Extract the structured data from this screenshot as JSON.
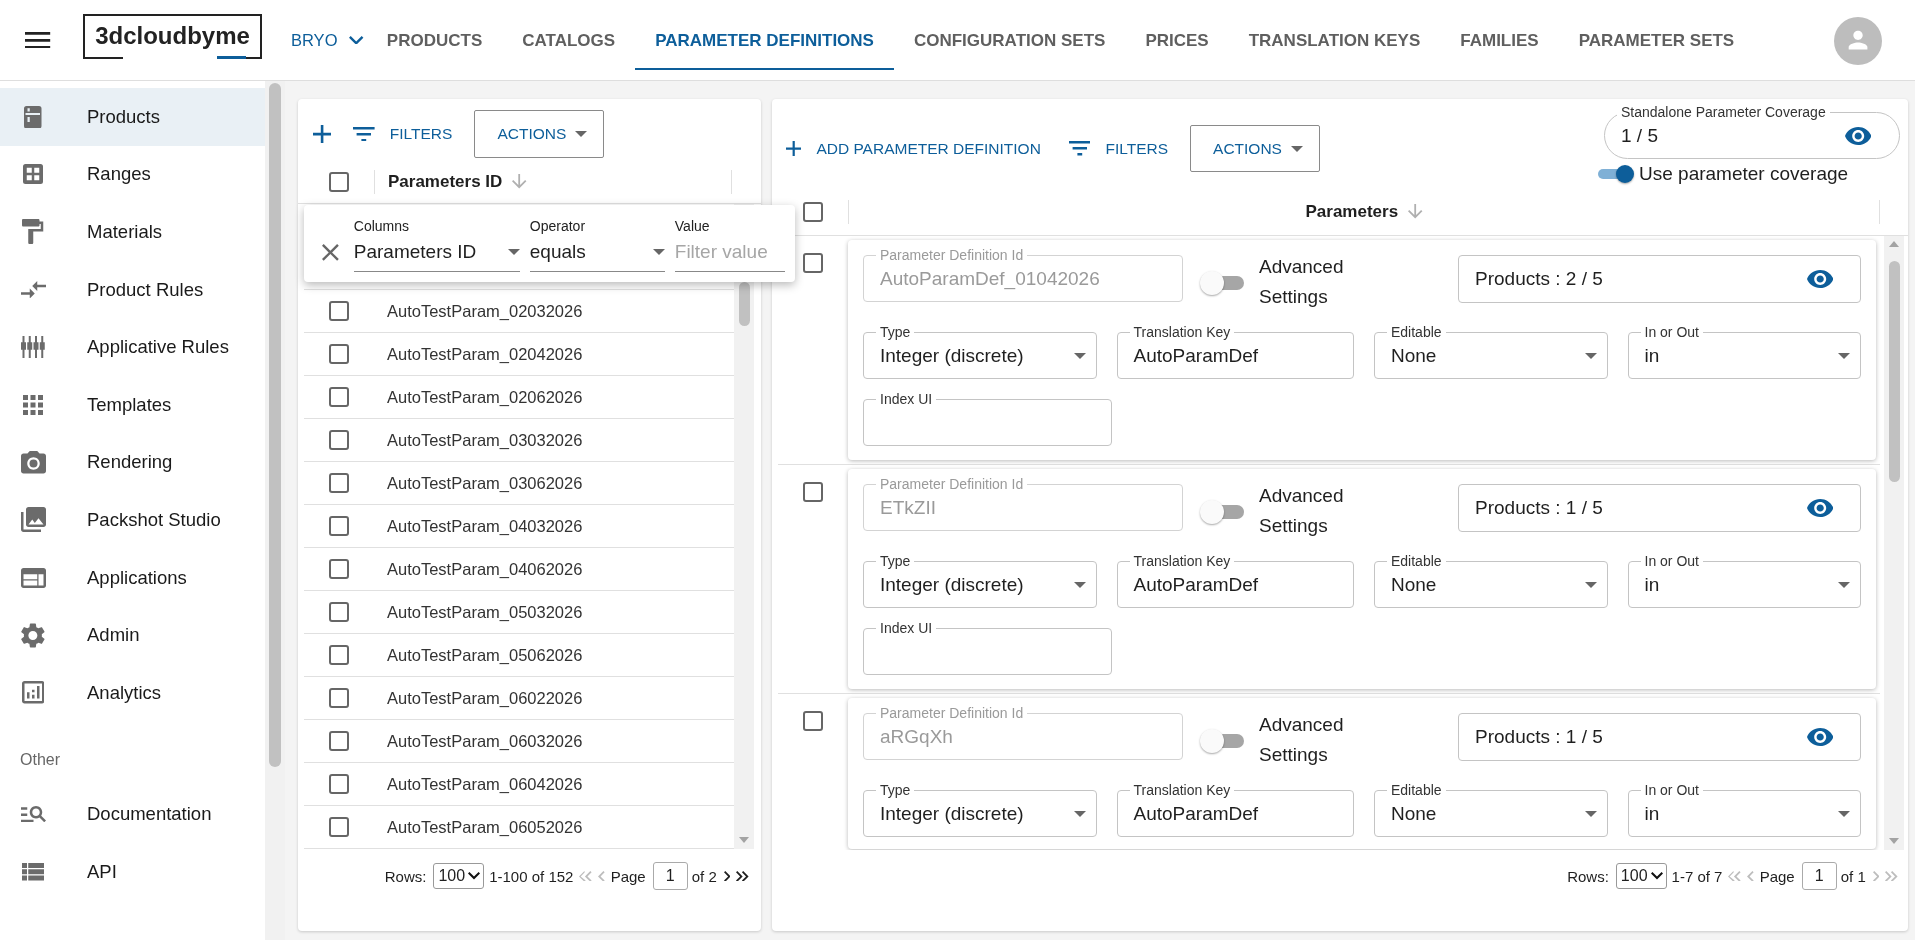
{
  "app_bar": {
    "logo": "3dcloudbyme",
    "workspace": "BRYO",
    "tabs": [
      {
        "label": "PRODUCTS",
        "selected": false
      },
      {
        "label": "CATALOGS",
        "selected": false
      },
      {
        "label": "PARAMETER DEFINITIONS",
        "selected": true
      },
      {
        "label": "CONFIGURATION SETS",
        "selected": false
      },
      {
        "label": "PRICES",
        "selected": false
      },
      {
        "label": "TRANSLATION KEYS",
        "selected": false
      },
      {
        "label": "FAMILIES",
        "selected": false
      },
      {
        "label": "PARAMETER SETS",
        "selected": false
      }
    ]
  },
  "sidebar": {
    "sections": [
      {
        "items": [
          {
            "label": "Products",
            "selected": true
          },
          {
            "label": "Ranges",
            "selected": false
          },
          {
            "label": "Materials",
            "selected": false
          },
          {
            "label": "Product Rules",
            "selected": false
          },
          {
            "label": "Applicative Rules",
            "selected": false
          },
          {
            "label": "Templates",
            "selected": false
          },
          {
            "label": "Rendering",
            "selected": false
          },
          {
            "label": "Packshot Studio",
            "selected": false
          },
          {
            "label": "Applications",
            "selected": false
          },
          {
            "label": "Admin",
            "selected": false
          },
          {
            "label": "Analytics",
            "selected": false
          }
        ]
      },
      {
        "title": "Other",
        "items": [
          {
            "label": "Documentation",
            "selected": false
          },
          {
            "label": "API",
            "selected": false
          }
        ]
      }
    ]
  },
  "parameters_panel": {
    "toolbar": {
      "filters": "FILTERS",
      "actions": "ACTIONS"
    },
    "table": {
      "header_checked": false,
      "column": "Parameters ID",
      "rows": [
        {
          "id": "AutoTestParam_02032026",
          "checked": false
        },
        {
          "id": "AutoTestParam_02042026",
          "checked": false
        },
        {
          "id": "AutoTestParam_02062026",
          "checked": false
        },
        {
          "id": "AutoTestParam_03032026",
          "checked": false
        },
        {
          "id": "AutoTestParam_03062026",
          "checked": false
        },
        {
          "id": "AutoTestParam_04032026",
          "checked": false
        },
        {
          "id": "AutoTestParam_04062026",
          "checked": false
        },
        {
          "id": "AutoTestParam_05032026",
          "checked": false
        },
        {
          "id": "AutoTestParam_05062026",
          "checked": false
        },
        {
          "id": "AutoTestParam_06022026",
          "checked": false
        },
        {
          "id": "AutoTestParam_06032026",
          "checked": false
        },
        {
          "id": "AutoTestParam_06042026",
          "checked": false
        },
        {
          "id": "AutoTestParam_06052026",
          "checked": false
        }
      ]
    },
    "filter_popup": {
      "fields": [
        {
          "kind": "select",
          "label": "Columns",
          "value": "Parameters ID"
        },
        {
          "kind": "select",
          "label": "Operator",
          "value": "equals"
        },
        {
          "kind": "input",
          "label": "Value",
          "placeholder": "Filter value"
        }
      ]
    },
    "pagination": {
      "rows_label": "Rows:",
      "page_size": "100",
      "range": "1-100 of 152",
      "first_page": {
        "disabled": true
      },
      "previous_page": {
        "disabled": true
      },
      "page_label": "Page",
      "page": "1",
      "page_count": "of 2",
      "next_page": {
        "disabled": false
      },
      "last_page": {
        "disabled": false
      }
    }
  },
  "definitions_panel": {
    "toolbar": {
      "add": "ADD PARAMETER DEFINITION",
      "filters": "FILTERS",
      "actions": "ACTIONS"
    },
    "coverage": {
      "label": "Standalone Parameter Coverage",
      "value": "1 / 5"
    },
    "use_coverage": {
      "label": "Use parameter coverage",
      "on": true
    },
    "table": {
      "header_checked": false,
      "column": "Parameters",
      "rows": [
        {
          "checked": false,
          "id_field": {
            "label": "Parameter Definition Id",
            "value": "AutoParamDef_01042026",
            "disabled": true
          },
          "advanced": {
            "label": "Advanced Settings",
            "on": false
          },
          "products": "Products : 2 / 5",
          "fields": [
            {
              "kind": "select",
              "label": "Type",
              "value": "Integer (discrete)"
            },
            {
              "kind": "input",
              "label": "Translation Key",
              "value": "AutoParamDef"
            },
            {
              "kind": "select",
              "label": "Editable",
              "value": "None"
            },
            {
              "kind": "select",
              "label": "In or Out",
              "value": "in"
            }
          ],
          "index_field": {
            "label": "Index UI"
          }
        },
        {
          "checked": false,
          "id_field": {
            "label": "Parameter Definition Id",
            "value": "ETkZII",
            "disabled": true
          },
          "advanced": {
            "label": "Advanced Settings",
            "on": false
          },
          "products": "Products : 1 / 5",
          "fields": [
            {
              "kind": "select",
              "label": "Type",
              "value": "Integer (discrete)"
            },
            {
              "kind": "input",
              "label": "Translation Key",
              "value": "AutoParamDef"
            },
            {
              "kind": "select",
              "label": "Editable",
              "value": "None"
            },
            {
              "kind": "select",
              "label": "In or Out",
              "value": "in"
            }
          ],
          "index_field": {
            "label": "Index UI"
          }
        },
        {
          "checked": false,
          "id_field": {
            "label": "Parameter Definition Id",
            "value": "aRGqXh",
            "disabled": true
          },
          "advanced": {
            "label": "Advanced Settings",
            "on": false
          },
          "products": "Products : 1 / 5",
          "fields": [
            {
              "kind": "select",
              "label": "Type",
              "value": "Integer (discrete)"
            },
            {
              "kind": "input",
              "label": "Translation Key",
              "value": "AutoParamDef"
            },
            {
              "kind": "select",
              "label": "Editable",
              "value": "None"
            },
            {
              "kind": "select",
              "label": "In or Out",
              "value": "in"
            }
          ]
        }
      ]
    },
    "pagination": {
      "rows_label": "Rows:",
      "page_size": "100",
      "range": "1-7 of 7",
      "first_page": {
        "disabled": true
      },
      "previous_page": {
        "disabled": true
      },
      "page_label": "Page",
      "page": "1",
      "page_count": "of 1",
      "next_page": {
        "disabled": true
      },
      "last_page": {
        "disabled": true
      }
    }
  }
}
